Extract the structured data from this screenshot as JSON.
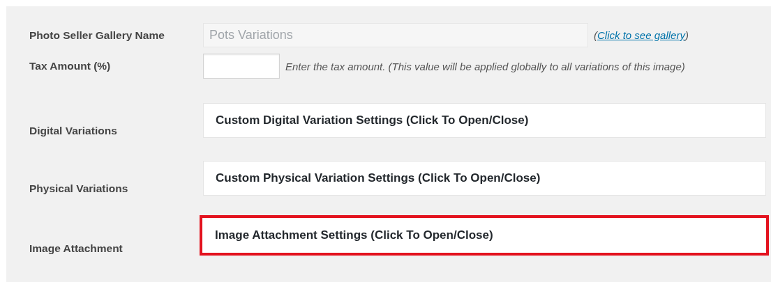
{
  "fields": [
    {
      "label": "Photo Seller Gallery Name",
      "value": "Pots Variations",
      "disabled": true,
      "note": {
        "before": "(",
        "link": "Click to see gallery",
        "after": ")"
      }
    },
    {
      "label": "Tax Amount (%)",
      "disabled": false,
      "hint": "Enter the tax amount. (This value will be applied globally to all variations of this image)"
    }
  ],
  "sections": [
    {
      "label": "Digital Variations",
      "title": "Custom Digital Variation Settings (Click To Open/Close)",
      "highlighted": false
    },
    {
      "label": "Physical Variations",
      "title": "Custom Physical Variation Settings (Click To Open/Close)",
      "highlighted": false
    },
    {
      "label": "Image Attachment",
      "title": "Image Attachment Settings (Click To Open/Close)",
      "highlighted": true
    }
  ]
}
